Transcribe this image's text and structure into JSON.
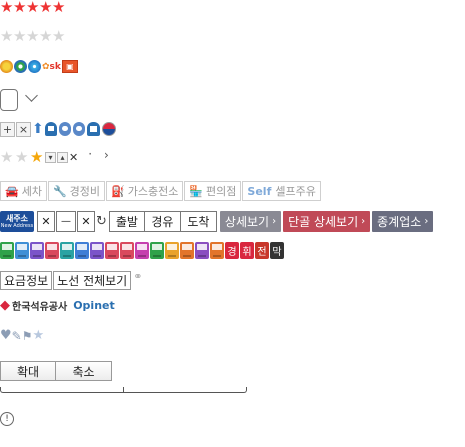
{
  "colors": {
    "star_red": "#ee3333",
    "star_gray": "#d6d6d6",
    "star_gold": "#f5a70a",
    "detail_gray": "#8a8a94",
    "detail_red": "#c04a57",
    "detail_dark": "#6a6d80",
    "opinet_blue": "#2a6fb0",
    "newaddr_blue": "#1d4e9a"
  },
  "rating_full": {
    "icon": "star-filled-icon",
    "count": 5
  },
  "rating_empty": {
    "icon": "star-empty-icon",
    "count": 5
  },
  "brand_logos": [
    "s-oil-logo-icon",
    "gs-caltex-logo-icon",
    "sk-energy-logo-icon",
    "hyundai-oilbank-logo-icon",
    "alddle-logo-icon"
  ],
  "brand_sk_label": "sk",
  "map_controls": {
    "icons": [
      "plus-icon",
      "close-icon",
      "arrow-up-icon",
      "pin-icon",
      "pin-icon",
      "pin-icon",
      "phone-icon",
      "taegeuk-icon"
    ],
    "plus": "+",
    "close": "×"
  },
  "rating_small": {
    "filled": 1,
    "total": 3
  },
  "small_controls": {
    "down": "▾",
    "up": "▴",
    "close": "✕",
    "dot": "·",
    "chevron": "›"
  },
  "facilities": [
    {
      "icon": "car-wash-icon",
      "label": "세차"
    },
    {
      "icon": "wrench-icon",
      "label": "경정비"
    },
    {
      "icon": "gas-charge-icon",
      "label": "가스충전소"
    },
    {
      "icon": "store-icon",
      "label": "편의점"
    },
    {
      "icon": "self-icon",
      "label": "셀프주유",
      "prefix": "Self"
    }
  ],
  "new_address": {
    "line1": "새주소",
    "line2": "New Address"
  },
  "window_buttons": {
    "close": "✕",
    "minimize": "—",
    "close2": "✕",
    "refresh": "↻"
  },
  "route_tabs": [
    "출발",
    "경유",
    "도착"
  ],
  "detail_buttons": [
    {
      "label": "상세보기",
      "arrow": "›"
    },
    {
      "label": "단골 상세보기",
      "arrow": "›"
    },
    {
      "label": "종계업소",
      "arrow": "›"
    }
  ],
  "pump_colors": [
    "#2fa24a",
    "#3f8fd6",
    "#7b55c9",
    "#d9495d",
    "#29a3a3",
    "#3f7ed6",
    "#7b55c9",
    "#d9495d",
    "#d9495d",
    "#c53fae",
    "#2fa24a",
    "#e9a22a",
    "#e2742a",
    "#8a4ec0",
    "#e2742a"
  ],
  "korean_badges": [
    {
      "label": "경",
      "color": "#d9273f"
    },
    {
      "label": "휘",
      "color": "#d9273f"
    },
    {
      "label": "전",
      "color": "#c8372b"
    },
    {
      "label": "막",
      "color": "#333333"
    }
  ],
  "info_buttons": [
    "요금정보",
    "노선 전체보기"
  ],
  "link_icon": "link-icon",
  "logo_knoc": "한국석유공사",
  "logo_opinet": "Opinet",
  "favorite_icons": [
    "heart-icon",
    "edit-icon",
    "flag-icon",
    "star-icon"
  ],
  "zoom": {
    "in": "확대",
    "out": "축소"
  },
  "alert_icon": "!"
}
